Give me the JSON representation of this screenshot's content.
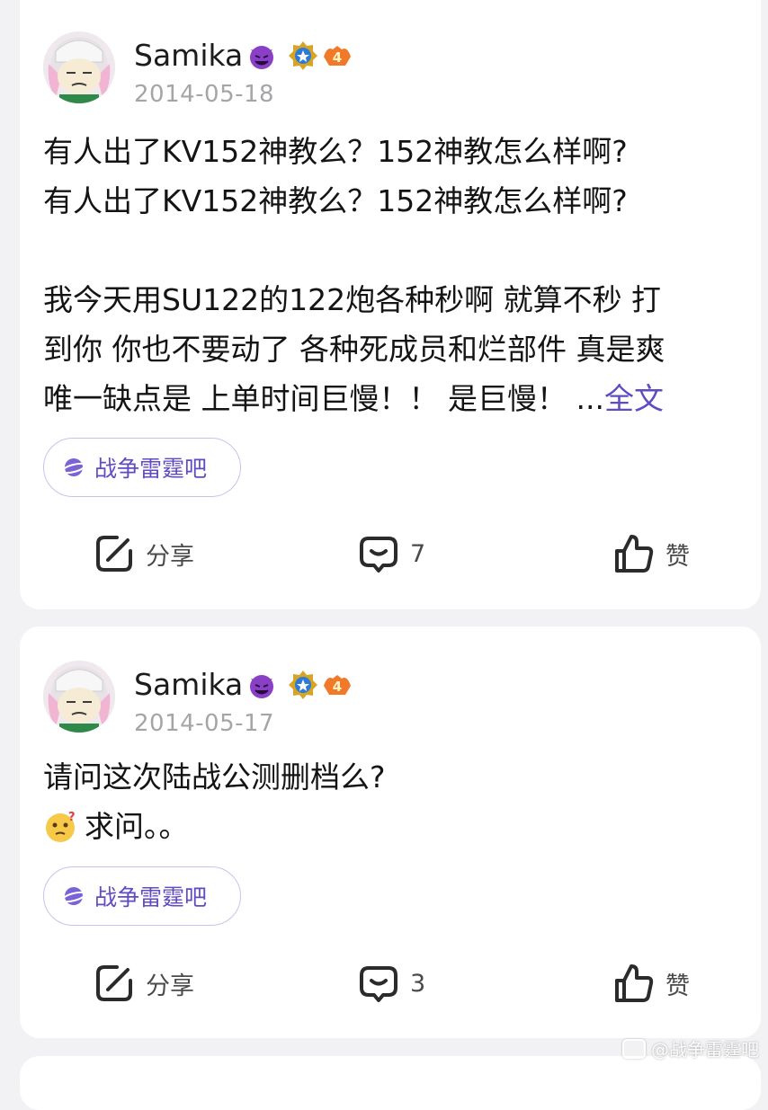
{
  "posts": [
    {
      "username": "Samika",
      "date": "2014-05-18",
      "content_lines": [
        "有人出了KV152神教么？152神教怎么样啊?",
        "有人出了KV152神教么？152神教怎么样啊?",
        "",
        "我今天用SU122的122炮各种秒啊 就算不秒 打",
        "到你 你也不要动了 各种死成员和烂部件 真是爽",
        "唯一缺点是 上单时间巨慢！！ 是巨慢！ ..."
      ],
      "more_label": "全文",
      "forum": "战争雷霆吧",
      "share_label": "分享",
      "comment_count": "7",
      "like_label": "赞"
    },
    {
      "username": "Samika",
      "date": "2014-05-17",
      "content_lines": [
        "请问这次陆战公测删档么?",
        "求问。。"
      ],
      "forum": "战争雷霆吧",
      "share_label": "分享",
      "comment_count": "3",
      "like_label": "赞"
    }
  ],
  "watermark": "@战争雷霆吧",
  "colors": {
    "accent": "#614bc3",
    "background": "#f2f2f5",
    "card": "#ffffff",
    "muted_text": "#a5a5a8"
  },
  "icons": [
    "devil-emoji-icon",
    "medal-badge-icon",
    "level-badge-icon",
    "forum-planet-icon",
    "share-icon",
    "comment-icon",
    "thumbs-up-icon",
    "thinking-emoji-icon"
  ]
}
